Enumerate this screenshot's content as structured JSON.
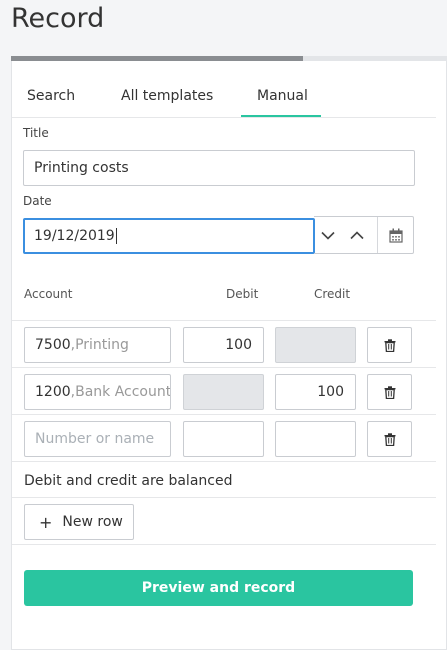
{
  "page": {
    "title": "Record"
  },
  "progress": {
    "value_percent": 67
  },
  "tabs": [
    {
      "label": "Search",
      "active": false
    },
    {
      "label": "All templates",
      "active": false
    },
    {
      "label": "Manual",
      "active": true
    }
  ],
  "form": {
    "title_label": "Title",
    "title_value": "Printing costs",
    "date_label": "Date",
    "date_value": "19/12/2019"
  },
  "table": {
    "headers": {
      "account": "Account",
      "debit": "Debit",
      "credit": "Credit"
    },
    "rows": [
      {
        "account_number": "7500",
        "account_name": ",Printing",
        "debit": "100",
        "credit": "",
        "debit_disabled": false,
        "credit_disabled": true
      },
      {
        "account_number": "1200",
        "account_name": ",Bank Account",
        "debit": "",
        "credit": "100",
        "debit_disabled": true,
        "credit_disabled": false
      },
      {
        "account_placeholder": "Number or name",
        "debit": "",
        "credit": ""
      }
    ]
  },
  "status": {
    "balance_message": "Debit and credit are balanced"
  },
  "actions": {
    "new_row_label": "New row",
    "preview_label": "Preview and record"
  },
  "colors": {
    "accent": "#2ac5a0",
    "focus": "#3b8fe0",
    "disabled": "#e4e6e9"
  }
}
